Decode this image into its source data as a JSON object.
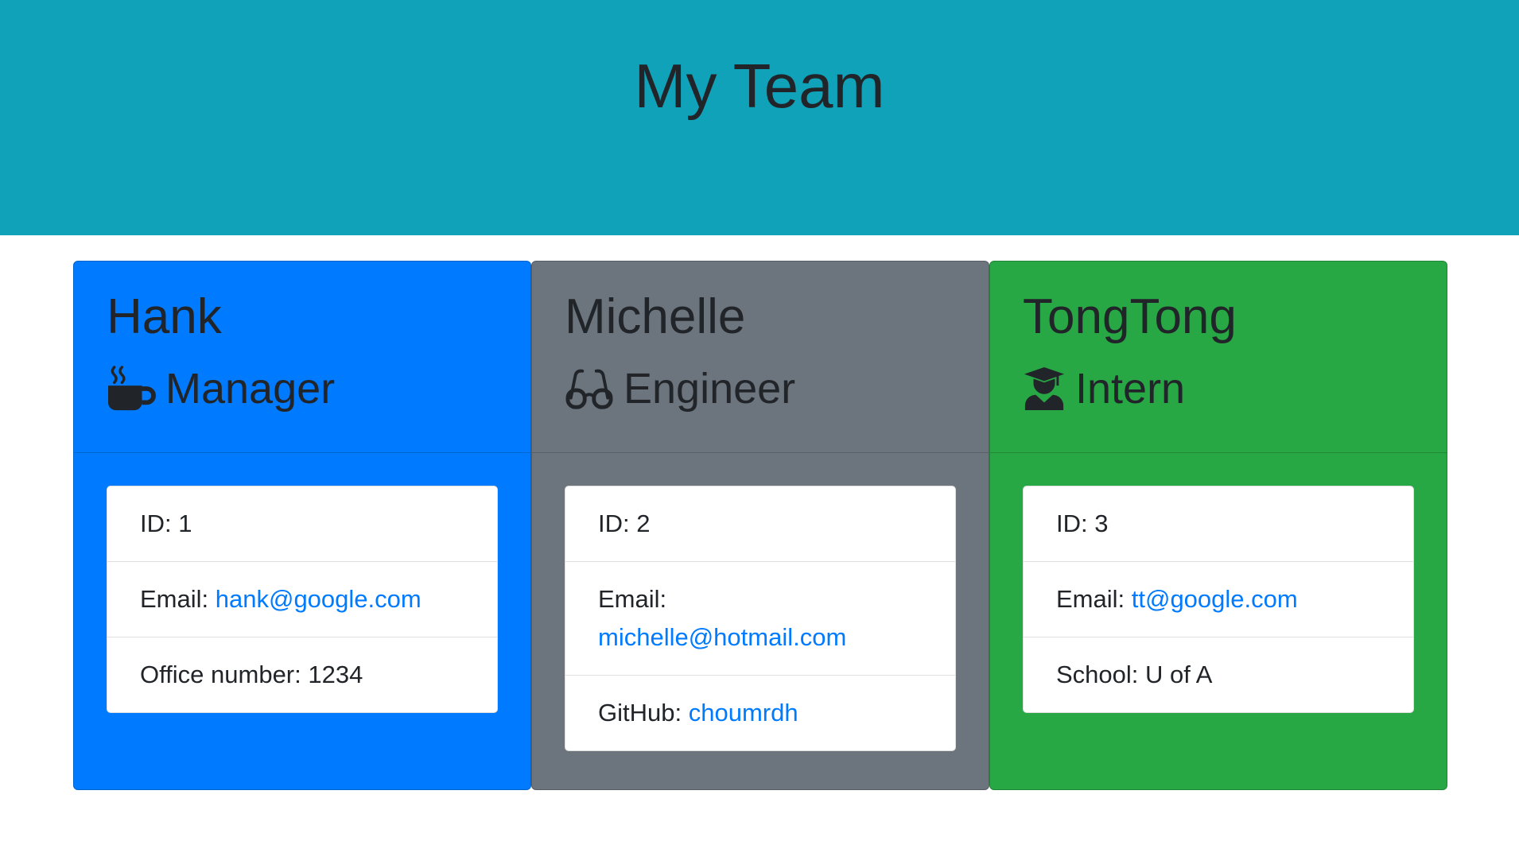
{
  "header": {
    "title": "My Team"
  },
  "cards": [
    {
      "name": "Hank",
      "role": "Manager",
      "icon": "coffee-icon",
      "color": "#007bff",
      "id_label": "ID: 1",
      "email_label": "Email: ",
      "email": "hank@google.com",
      "extra_label": "Office number: 1234"
    },
    {
      "name": "Michelle",
      "role": "Engineer",
      "icon": "glasses-icon",
      "color": "#6c757d",
      "id_label": "ID: 2",
      "email_label": "Email: ",
      "email": "michelle@hotmail.com",
      "extra_label": "GitHub: ",
      "extra_link": "choumrdh"
    },
    {
      "name": "TongTong",
      "role": "Intern",
      "icon": "user-graduate-icon",
      "color": "#28a745",
      "id_label": "ID: 3",
      "email_label": "Email: ",
      "email": "tt@google.com",
      "extra_label": "School: U of A"
    }
  ]
}
